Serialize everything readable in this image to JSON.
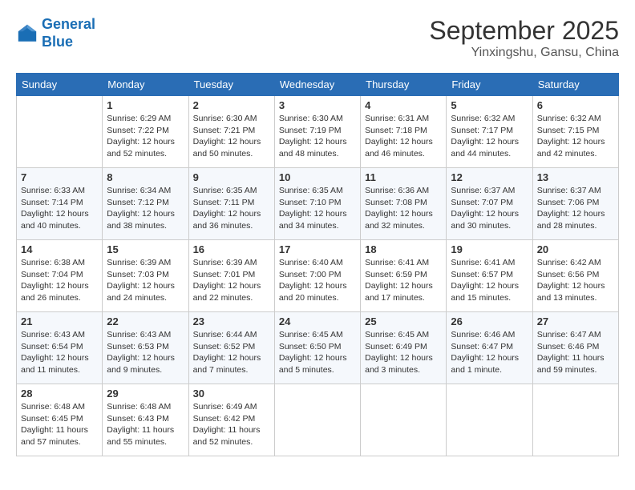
{
  "header": {
    "logo_line1": "General",
    "logo_line2": "Blue",
    "month": "September 2025",
    "location": "Yinxingshu, Gansu, China"
  },
  "weekdays": [
    "Sunday",
    "Monday",
    "Tuesday",
    "Wednesday",
    "Thursday",
    "Friday",
    "Saturday"
  ],
  "weeks": [
    [
      {
        "day": "",
        "info": ""
      },
      {
        "day": "1",
        "info": "Sunrise: 6:29 AM\nSunset: 7:22 PM\nDaylight: 12 hours\nand 52 minutes."
      },
      {
        "day": "2",
        "info": "Sunrise: 6:30 AM\nSunset: 7:21 PM\nDaylight: 12 hours\nand 50 minutes."
      },
      {
        "day": "3",
        "info": "Sunrise: 6:30 AM\nSunset: 7:19 PM\nDaylight: 12 hours\nand 48 minutes."
      },
      {
        "day": "4",
        "info": "Sunrise: 6:31 AM\nSunset: 7:18 PM\nDaylight: 12 hours\nand 46 minutes."
      },
      {
        "day": "5",
        "info": "Sunrise: 6:32 AM\nSunset: 7:17 PM\nDaylight: 12 hours\nand 44 minutes."
      },
      {
        "day": "6",
        "info": "Sunrise: 6:32 AM\nSunset: 7:15 PM\nDaylight: 12 hours\nand 42 minutes."
      }
    ],
    [
      {
        "day": "7",
        "info": "Sunrise: 6:33 AM\nSunset: 7:14 PM\nDaylight: 12 hours\nand 40 minutes."
      },
      {
        "day": "8",
        "info": "Sunrise: 6:34 AM\nSunset: 7:12 PM\nDaylight: 12 hours\nand 38 minutes."
      },
      {
        "day": "9",
        "info": "Sunrise: 6:35 AM\nSunset: 7:11 PM\nDaylight: 12 hours\nand 36 minutes."
      },
      {
        "day": "10",
        "info": "Sunrise: 6:35 AM\nSunset: 7:10 PM\nDaylight: 12 hours\nand 34 minutes."
      },
      {
        "day": "11",
        "info": "Sunrise: 6:36 AM\nSunset: 7:08 PM\nDaylight: 12 hours\nand 32 minutes."
      },
      {
        "day": "12",
        "info": "Sunrise: 6:37 AM\nSunset: 7:07 PM\nDaylight: 12 hours\nand 30 minutes."
      },
      {
        "day": "13",
        "info": "Sunrise: 6:37 AM\nSunset: 7:06 PM\nDaylight: 12 hours\nand 28 minutes."
      }
    ],
    [
      {
        "day": "14",
        "info": "Sunrise: 6:38 AM\nSunset: 7:04 PM\nDaylight: 12 hours\nand 26 minutes."
      },
      {
        "day": "15",
        "info": "Sunrise: 6:39 AM\nSunset: 7:03 PM\nDaylight: 12 hours\nand 24 minutes."
      },
      {
        "day": "16",
        "info": "Sunrise: 6:39 AM\nSunset: 7:01 PM\nDaylight: 12 hours\nand 22 minutes."
      },
      {
        "day": "17",
        "info": "Sunrise: 6:40 AM\nSunset: 7:00 PM\nDaylight: 12 hours\nand 20 minutes."
      },
      {
        "day": "18",
        "info": "Sunrise: 6:41 AM\nSunset: 6:59 PM\nDaylight: 12 hours\nand 17 minutes."
      },
      {
        "day": "19",
        "info": "Sunrise: 6:41 AM\nSunset: 6:57 PM\nDaylight: 12 hours\nand 15 minutes."
      },
      {
        "day": "20",
        "info": "Sunrise: 6:42 AM\nSunset: 6:56 PM\nDaylight: 12 hours\nand 13 minutes."
      }
    ],
    [
      {
        "day": "21",
        "info": "Sunrise: 6:43 AM\nSunset: 6:54 PM\nDaylight: 12 hours\nand 11 minutes."
      },
      {
        "day": "22",
        "info": "Sunrise: 6:43 AM\nSunset: 6:53 PM\nDaylight: 12 hours\nand 9 minutes."
      },
      {
        "day": "23",
        "info": "Sunrise: 6:44 AM\nSunset: 6:52 PM\nDaylight: 12 hours\nand 7 minutes."
      },
      {
        "day": "24",
        "info": "Sunrise: 6:45 AM\nSunset: 6:50 PM\nDaylight: 12 hours\nand 5 minutes."
      },
      {
        "day": "25",
        "info": "Sunrise: 6:45 AM\nSunset: 6:49 PM\nDaylight: 12 hours\nand 3 minutes."
      },
      {
        "day": "26",
        "info": "Sunrise: 6:46 AM\nSunset: 6:47 PM\nDaylight: 12 hours\nand 1 minute."
      },
      {
        "day": "27",
        "info": "Sunrise: 6:47 AM\nSunset: 6:46 PM\nDaylight: 11 hours\nand 59 minutes."
      }
    ],
    [
      {
        "day": "28",
        "info": "Sunrise: 6:48 AM\nSunset: 6:45 PM\nDaylight: 11 hours\nand 57 minutes."
      },
      {
        "day": "29",
        "info": "Sunrise: 6:48 AM\nSunset: 6:43 PM\nDaylight: 11 hours\nand 55 minutes."
      },
      {
        "day": "30",
        "info": "Sunrise: 6:49 AM\nSunset: 6:42 PM\nDaylight: 11 hours\nand 52 minutes."
      },
      {
        "day": "",
        "info": ""
      },
      {
        "day": "",
        "info": ""
      },
      {
        "day": "",
        "info": ""
      },
      {
        "day": "",
        "info": ""
      }
    ]
  ]
}
